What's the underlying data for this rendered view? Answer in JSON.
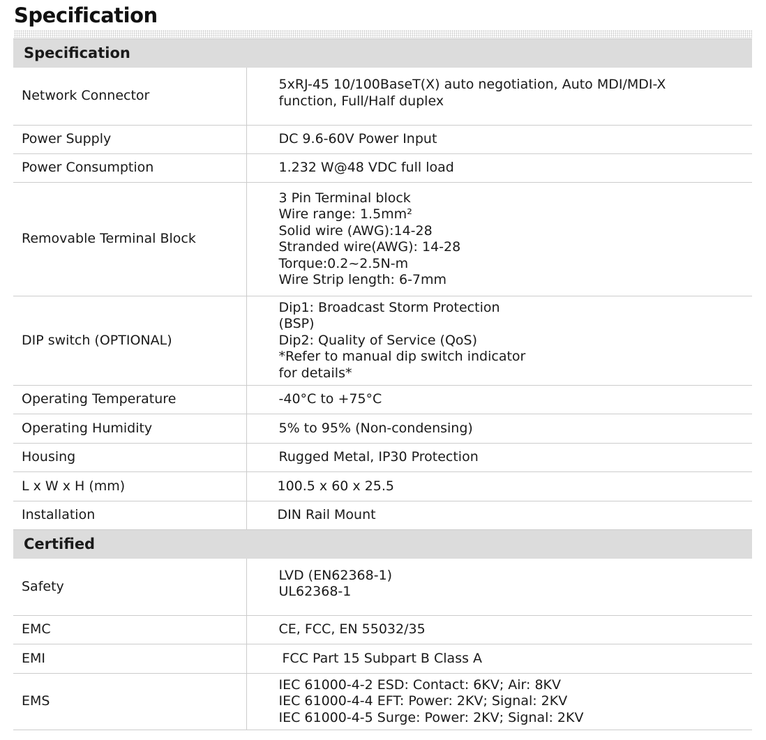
{
  "page": {
    "title": "Specification"
  },
  "sections": [
    {
      "heading": "Specification",
      "rows": [
        {
          "label": "Network Connector",
          "lines": [
            "5xRJ-45 10/100BaseT(X) auto negotiation, Auto MDI/MDI-X",
            "function, Full/Half duplex"
          ]
        },
        {
          "label": "Power Supply",
          "lines": [
            "DC 9.6-60V Power Input"
          ]
        },
        {
          "label": "Power Consumption",
          "lines": [
            "1.232 W@48 VDC full load"
          ]
        },
        {
          "label": "Removable Terminal Block",
          "lines": [
            "3 Pin Terminal block",
            "Wire range: 1.5mm²",
            "Solid wire (AWG):14-28",
            "Stranded wire(AWG): 14-28",
            "Torque:0.2~2.5N-m",
            "Wire Strip length: 6-7mm"
          ]
        },
        {
          "label": "DIP switch (OPTIONAL)",
          "lines": [
            "Dip1: Broadcast Storm Protection",
            "(BSP)",
            "Dip2: Quality of Service (QoS)",
            "*Refer to manual dip switch indicator",
            "for details*"
          ]
        },
        {
          "label": "Operating Temperature",
          "lines": [
            "-40°C to +75°C"
          ]
        },
        {
          "label": "Operating Humidity",
          "lines": [
            "5% to 95% (Non-condensing)"
          ]
        },
        {
          "label": "Housing",
          "lines": [
            "Rugged Metal, IP30 Protection"
          ]
        },
        {
          "label": "L x W x H (mm)",
          "lines": [
            "100.5 x 60 x 25.5"
          ]
        },
        {
          "label": "Installation",
          "lines": [
            "DIN Rail Mount"
          ]
        }
      ]
    },
    {
      "heading": "Certified",
      "rows": [
        {
          "label": "Safety",
          "lines": [
            "LVD (EN62368-1)",
            "UL62368-1"
          ]
        },
        {
          "label": "EMC",
          "lines": [
            "CE, FCC, EN 55032/35"
          ]
        },
        {
          "label": "EMI",
          "lines": [
            "FCC Part 15 Subpart B Class A"
          ]
        },
        {
          "label": "EMS",
          "lines": [
            "IEC 61000-4-2 ESD: Contact: 6KV; Air: 8KV",
            "IEC 61000-4-4 EFT: Power: 2KV; Signal: 2KV",
            "IEC 61000-4-5 Surge: Power: 2KV; Signal: 2KV"
          ]
        }
      ]
    }
  ]
}
